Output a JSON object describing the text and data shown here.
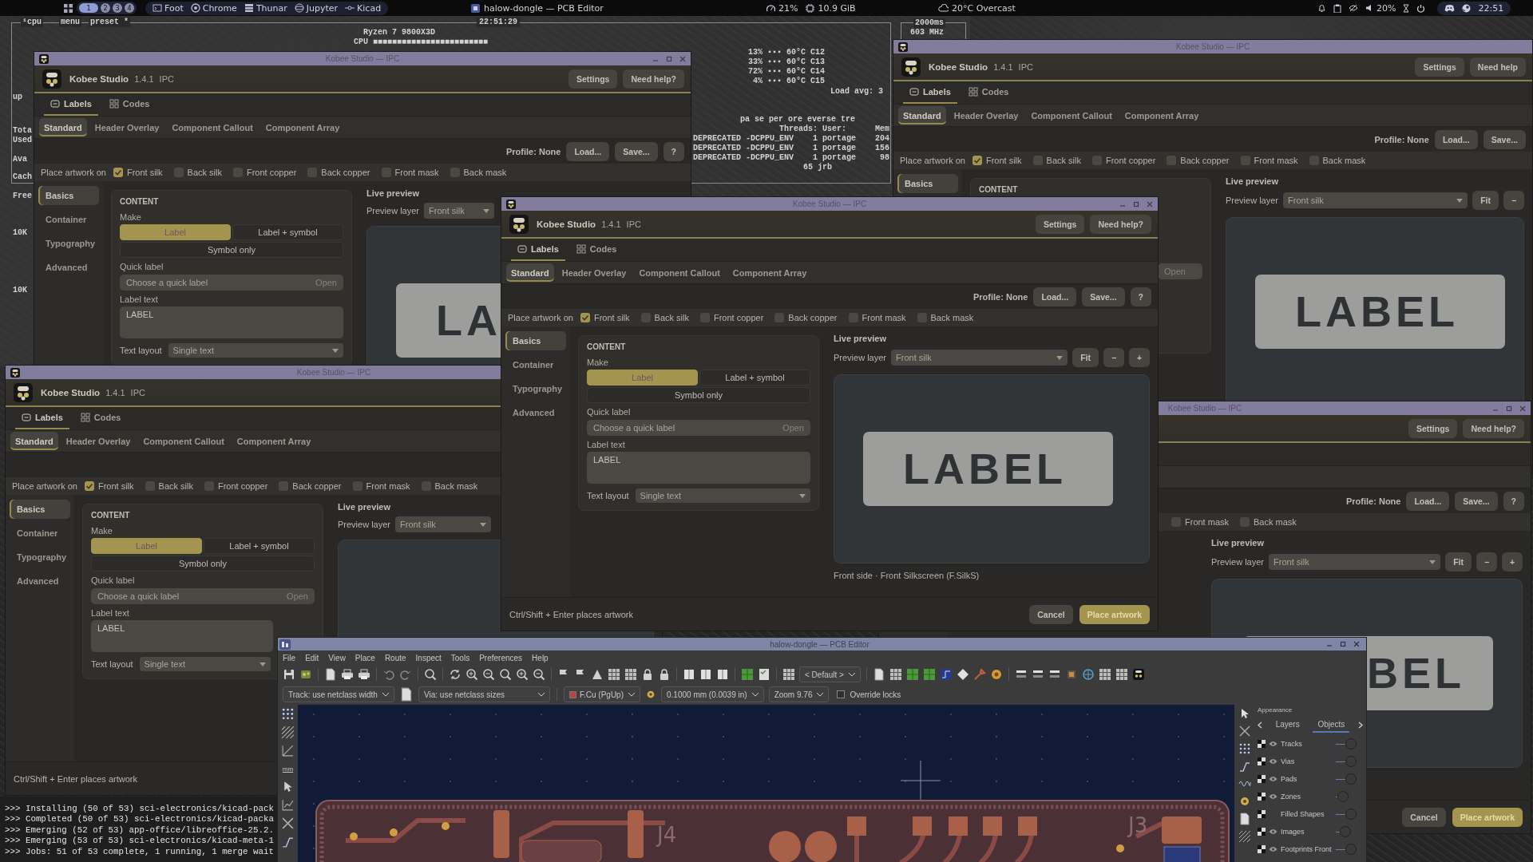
{
  "top_bar": {
    "workspaces": [
      {
        "label": "1",
        "selected": true
      },
      {
        "label": "2",
        "selected": false
      },
      {
        "label": "3",
        "selected": false
      },
      {
        "label": "4",
        "selected": false
      }
    ],
    "apps": [
      "Foot",
      "Chrome",
      "Thunar",
      "Jupyter",
      "Kicad"
    ],
    "active_window": "halow-dongle — PCB Editor",
    "cpu": "21%",
    "memory": "10.9 GiB",
    "weather": "20°C Overcast",
    "volume": "20%",
    "clock": "22:51"
  },
  "system_monitor": {
    "tabs": [
      "¹cpu",
      "menu",
      "preset *"
    ],
    "clock": "22:51:29",
    "cpu_model": "Ryzen 7 9800X3D",
    "cpu_meter": "CPU ■■■■■■■■■■■■■■■■■■■■■■■■",
    "interval": "2000ms",
    "frequency": "603 MHz",
    "memory_labels": [
      "up",
      "Tota",
      "Used",
      "Ava",
      "Cach",
      "Free",
      "10K",
      "10K"
    ],
    "core_rows": [
      "13% ▪▪▪ 60°C C12",
      "33% ▪▪▪ 60°C C13",
      "72% ▪▪▪ 60°C C14",
      " 4% ▪▪▪ 60°C C15"
    ],
    "load": "Load avg: 3",
    "process_options": "pa se per ore everse tre",
    "process_header": "Threads: User:      Mem",
    "process_rows": [
      "DEPRECATED -DCPPU_ENV    1 portage    204",
      "DEPRECATED -DCPPU_ENV    1 portage    156",
      "DEPRECATED -DCPPU_ENV    1 portage     98",
      "                       65 jrb"
    ]
  },
  "kobee_windows": [
    {
      "title": "Kobee Studio — IPC",
      "app": "Kobee Studio",
      "version": "1.4.1",
      "mode": "IPC",
      "header_buttons": [
        "Settings",
        "Need help"
      ],
      "tabs": [
        {
          "label": "Labels",
          "selected": true
        },
        {
          "label": "Codes",
          "selected": false
        }
      ],
      "subtabs": [
        {
          "label": "Standard",
          "selected": true
        },
        {
          "label": "Header Overlay",
          "selected": false
        },
        {
          "label": "Component Callout",
          "selected": false
        },
        {
          "label": "Component Array",
          "selected": false
        }
      ],
      "profile": "Profile: None",
      "profile_buttons": [
        "Load...",
        "Save..."
      ],
      "place_label": "Place artwork on",
      "place_options": [
        {
          "label": "Front silk",
          "checked": true
        },
        {
          "label": "Back silk",
          "checked": false
        },
        {
          "label": "Front copper",
          "checked": false
        },
        {
          "label": "Back copper",
          "checked": false
        },
        {
          "label": "Front mask",
          "checked": false
        },
        {
          "label": "Back mask",
          "checked": false
        }
      ],
      "sidebar": [
        {
          "label": "Basics",
          "selected": true
        }
      ],
      "content": {
        "heading": "CONTENT",
        "quick_action": "Open"
      },
      "preview": {
        "heading": "Live preview",
        "layer_label": "Preview layer",
        "layer_value": "Front silk",
        "buttons": [
          "Fit",
          "−"
        ],
        "sample": "LABEL"
      }
    },
    {
      "title": "Kobee Studio — IPC",
      "app": "Kobee Studio",
      "version": "1.4.1",
      "mode": "IPC",
      "header_buttons": [
        "Settings",
        "Need help?"
      ],
      "tabs": [
        {
          "label": "Labels",
          "selected": true
        },
        {
          "label": "Codes",
          "selected": false
        }
      ],
      "subtabs": [
        {
          "label": "Standard",
          "selected": true
        },
        {
          "label": "Header Overlay",
          "selected": false
        },
        {
          "label": "Component Callout",
          "selected": false
        },
        {
          "label": "Component Array",
          "selected": false
        }
      ],
      "profile": "Profile: None",
      "profile_buttons": [
        "Load...",
        "Save...",
        "?"
      ],
      "place_label": "Place artwork on",
      "place_options": [
        {
          "label": "Front silk",
          "checked": true
        },
        {
          "label": "Back silk",
          "checked": false
        },
        {
          "label": "Front copper",
          "checked": false
        },
        {
          "label": "Back copper",
          "checked": false
        },
        {
          "label": "Front mask",
          "checked": false
        },
        {
          "label": "Back mask",
          "checked": false
        }
      ],
      "sidebar": [
        {
          "label": "Basics",
          "selected": true
        },
        {
          "label": "Container",
          "selected": false
        },
        {
          "label": "Typography",
          "selected": false
        },
        {
          "label": "Advanced",
          "selected": false
        }
      ],
      "content": {
        "heading": "CONTENT",
        "make_label": "Make",
        "make_options": [
          {
            "label": "Label",
            "selected": true
          },
          {
            "label": "Label + symbol",
            "selected": false
          },
          {
            "label": "Symbol only",
            "selected": false
          }
        ],
        "quick_label": "Quick label",
        "quick_placeholder": "Choose a quick label",
        "quick_action": "Open",
        "text_label": "Label text",
        "text_value": "LABEL",
        "layout_label": "Text layout",
        "layout_value": "Single text"
      },
      "preview": {
        "heading": "Live preview",
        "layer_label": "Preview layer",
        "layer_value": "Front silk",
        "sample": "LA"
      }
    },
    {
      "title": "Kobee Studio — IPC",
      "app": "Kobee Studio",
      "version": "1.4.1",
      "mode": "IPC",
      "header_buttons": [
        "Settings",
        "Need help?"
      ],
      "tabs": [
        {
          "label": "Labels",
          "selected": true
        },
        {
          "label": "Codes",
          "selected": false
        }
      ],
      "subtabs": [
        {
          "label": "Standard",
          "selected": true
        },
        {
          "label": "Header Overlay",
          "selected": false
        },
        {
          "label": "Component Callout",
          "selected": false
        },
        {
          "label": "Component Array",
          "selected": false
        }
      ],
      "profile": "Profile: None",
      "profile_buttons": [
        "Load...",
        "Save...",
        "?"
      ],
      "place_label": "Place artwork on",
      "place_options": [
        {
          "label": "Front silk",
          "checked": true
        },
        {
          "label": "Back silk",
          "checked": false
        },
        {
          "label": "Front copper",
          "checked": false
        },
        {
          "label": "Back copper",
          "checked": false
        },
        {
          "label": "Front mask",
          "checked": false
        },
        {
          "label": "Back mask",
          "checked": false
        }
      ],
      "sidebar": [
        {
          "label": "Basics",
          "selected": true
        },
        {
          "label": "Container",
          "selected": false
        },
        {
          "label": "Typography",
          "selected": false
        },
        {
          "label": "Advanced",
          "selected": false
        }
      ],
      "content": {
        "heading": "CONTENT",
        "make_label": "Make",
        "make_options": [
          {
            "label": "Label",
            "selected": true
          },
          {
            "label": "Label + symbol",
            "selected": false
          },
          {
            "label": "Symbol only",
            "selected": false
          }
        ],
        "quick_label": "Quick label",
        "quick_placeholder": "Choose a quick label",
        "quick_action": "Open",
        "text_label": "Label text",
        "text_value": "LABEL",
        "layout_label": "Text layout",
        "layout_value": "Single text"
      },
      "preview": {
        "heading": "Live preview",
        "layer_label": "Preview layer",
        "layer_value": "Front silk",
        "buttons": [
          "Fit",
          "−",
          "+"
        ],
        "sample": "LABEL",
        "caption": "Front side · Front Silkscreen (F.SilkS)"
      },
      "hint": "Ctrl/Shift + Enter places artwork",
      "footer_buttons": [
        {
          "label": "Cancel",
          "kind": "secondary"
        },
        {
          "label": "Place artwork",
          "kind": "primary"
        }
      ]
    },
    {
      "title": "Kobee Studio — IPC",
      "app": "Kobee Studio",
      "version": "1.4.1",
      "mode": "IPC",
      "tabs": [
        {
          "label": "Labels",
          "selected": true
        },
        {
          "label": "Codes",
          "selected": false
        }
      ],
      "subtabs": [
        {
          "label": "Standard",
          "selected": true
        },
        {
          "label": "Header Overlay",
          "selected": false
        },
        {
          "label": "Component Callout",
          "selected": false
        },
        {
          "label": "Component Array",
          "selected": false
        }
      ],
      "place_label": "Place artwork on",
      "place_options": [
        {
          "label": "Front silk",
          "checked": true
        },
        {
          "label": "Back silk",
          "checked": false
        },
        {
          "label": "Front copper",
          "checked": false
        },
        {
          "label": "Back copper",
          "checked": false
        },
        {
          "label": "Front mask",
          "checked": false
        },
        {
          "label": "Back mask",
          "checked": false
        }
      ],
      "sidebar": [
        {
          "label": "Basics",
          "selected": true
        },
        {
          "label": "Container",
          "selected": false
        },
        {
          "label": "Typography",
          "selected": false
        },
        {
          "label": "Advanced",
          "selected": false
        }
      ],
      "content": {
        "heading": "CONTENT",
        "make_label": "Make",
        "make_options": [
          {
            "label": "Label",
            "selected": true
          },
          {
            "label": "Label + symbol",
            "selected": false
          },
          {
            "label": "Symbol only",
            "selected": false
          }
        ],
        "quick_label": "Quick label",
        "quick_placeholder": "Choose a quick label",
        "quick_action": "Open",
        "text_label": "Label text",
        "text_value": "LABEL",
        "layout_label": "Text layout",
        "layout_value": "Single text"
      },
      "preview": {
        "heading": "Live preview",
        "layer_label": "Preview layer",
        "layer_value": "Front silk"
      },
      "hint": "Ctrl/Shift + Enter places artwork"
    },
    {
      "title": "Kobee Studio — IPC",
      "header_buttons": [
        "Settings",
        "Need help?"
      ],
      "profile": "Profile: None",
      "profile_buttons": [
        "Load...",
        "Save...",
        "?"
      ],
      "place_options": [
        {
          "label": "Front mask",
          "checked": false
        },
        {
          "label": "Back mask",
          "checked": false
        }
      ],
      "preview": {
        "heading": "Live preview",
        "layer_label": "Preview layer",
        "layer_value": "Front silk",
        "buttons": [
          "Fit",
          "−",
          "+"
        ],
        "sample": "BEL"
      },
      "footer_buttons": [
        {
          "label": "Cancel",
          "kind": "secondary"
        },
        {
          "label": "Place artwork",
          "kind": "primary"
        }
      ]
    }
  ],
  "terminal": {
    "lines": [
      ">>> Installing (50 of 53) sci-electronics/kicad-pack",
      ">>> Completed (50 of 53) sci-electronics/kicad-packa",
      ">>> Emerging (52 of 53) app-office/libreoffice-25.2.",
      ">>> Emerging (53 of 53) sci-electronics/kicad-meta-1",
      ">>> Jobs: 51 of 53 complete, 1 running, 1 merge wait"
    ]
  },
  "pcb_editor": {
    "title": "halow-dongle — PCB Editor",
    "menu": [
      "File",
      "Edit",
      "View",
      "Place",
      "Route",
      "Inspect",
      "Tools",
      "Preferences",
      "Help"
    ],
    "preset": "< Default >",
    "track": "Track: use netclass width",
    "via": "Via: use netclass sizes",
    "layer": "F.Cu (PgUp)",
    "grid": "0.1000 mm (0.0039 in)",
    "zoom": "Zoom 9.76",
    "override_locks": {
      "label": "Override locks",
      "checked": false
    },
    "units": "mm",
    "board_labels": [
      "J4",
      "J3"
    ],
    "appearance": {
      "title": "Appearance",
      "tabs": [
        {
          "label": "Layers",
          "selected": false
        },
        {
          "label": "Objects",
          "selected": true
        }
      ],
      "objects": [
        {
          "name": "Tracks",
          "visible": true,
          "level": 1
        },
        {
          "name": "Vias",
          "visible": true,
          "level": 1
        },
        {
          "name": "Pads",
          "visible": true,
          "level": 1
        },
        {
          "name": "Zones",
          "visible": true,
          "level": 0.2
        },
        {
          "name": "Filled Shapes",
          "visible": false,
          "level": 1
        },
        {
          "name": "Images",
          "visible": true,
          "level": 0.4
        },
        {
          "name": "Footprints Front",
          "visible": true,
          "level": 1
        }
      ]
    }
  }
}
